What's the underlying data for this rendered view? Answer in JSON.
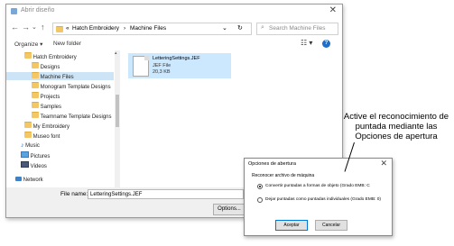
{
  "window": {
    "title": "Abrir diseño",
    "address": {
      "sep": "«",
      "crumbs": [
        "Hatch Embroidery",
        "Machine Files"
      ]
    },
    "search_placeholder": "Search Machine Files",
    "toolbar": {
      "organize": "Organize ▾",
      "new_folder": "New folder"
    },
    "nav_items": [
      {
        "label": "Hatch Embroidery",
        "icon": "folder-icon"
      },
      {
        "label": "Designs",
        "icon": "folder-icon"
      },
      {
        "label": "Machine Files",
        "icon": "folder-icon",
        "selected": true
      },
      {
        "label": "Monogram Template Designs",
        "icon": "folder-icon"
      },
      {
        "label": "Projects",
        "icon": "folder-icon"
      },
      {
        "label": "Samples",
        "icon": "folder-icon"
      },
      {
        "label": "Teamname Template Designs",
        "icon": "folder-icon"
      },
      {
        "label": "My Embroidery",
        "icon": "folder-icon"
      },
      {
        "label": "Museo font",
        "icon": "folder-icon"
      },
      {
        "label": "Music",
        "icon": "music-icon"
      },
      {
        "label": "Pictures",
        "icon": "pictures-icon"
      },
      {
        "label": "Videos",
        "icon": "videos-icon"
      },
      {
        "label": "Network",
        "icon": "network-icon"
      }
    ],
    "file": {
      "name": "LetteringSettings.JEF",
      "type": "JEF File",
      "size": "20,3 KB"
    },
    "filename_label": "File name:",
    "filename_value": "LetteringSettings.JEF",
    "options_button": "Options..."
  },
  "dialog": {
    "title": "Opciones de abertura",
    "group": "Reconocer archivo de máquina",
    "options": [
      {
        "label": "Convertir puntadas a formas de objeto (Grado EMB: C",
        "checked": true
      },
      {
        "label": "Dejar puntadas como puntadas individuales (Grado EMB: 0)",
        "checked": false
      }
    ],
    "accept": "Aceptar",
    "cancel": "Cancelar"
  },
  "callout": "Active el reconocimiento de puntada mediante las Opciones de apertura",
  "colors": {
    "selection": "#cde4f7",
    "file_selected": "#cce8ff",
    "accent": "#0078d7"
  }
}
